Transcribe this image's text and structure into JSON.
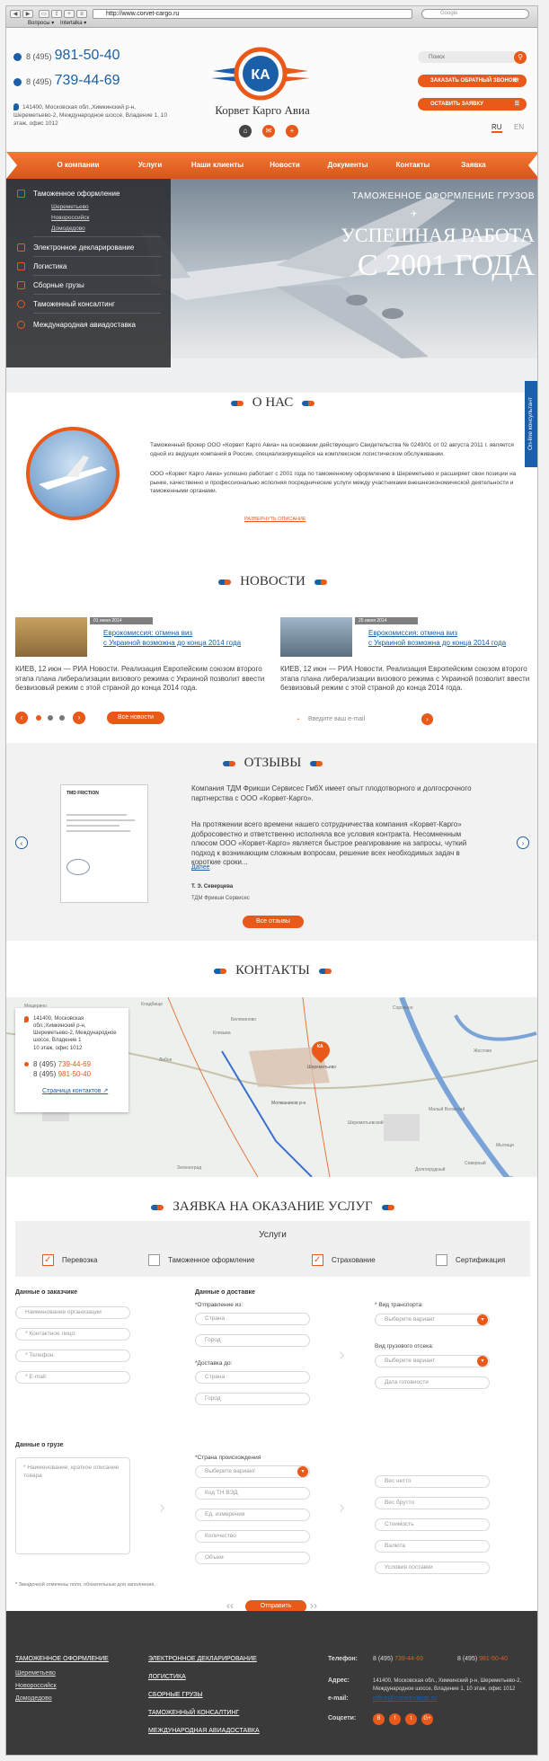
{
  "browser": {
    "url": "http://www.corvet-cargo.ru",
    "search_placeholder": "Google",
    "bookmark1": "Вопросы ▾",
    "bookmark2": "Intertalka ▾"
  },
  "header": {
    "phone_prefix": "8 (495)",
    "phone1": "981-50-40",
    "phone2": "739-44-69",
    "address": "141400, Московская обл.,Химкинский р-н, Шереметьево-2, Международное шоссе, Владение 1, 10 этаж, офис 1012",
    "logo_abbr": "КА",
    "logo_text": "Корвет Карго Авиа",
    "search_placeholder": "Поиск",
    "callback_label": "ЗАКАЗАТЬ ОБРАТНЫЙ ЗВОНОК",
    "request_label": "ОСТАВИТЬ ЗАЯВКУ",
    "lang_ru": "RU",
    "lang_en": "EN"
  },
  "nav": [
    "О компании",
    "Услуги",
    "Наши клиенты",
    "Новости",
    "Документы",
    "Контакты",
    "Заявка"
  ],
  "side_menu": {
    "customs": "Таможенное оформление",
    "subs": [
      "Шереметьево",
      "Новороссийск",
      "Домодедово"
    ],
    "items": [
      "Электронное декларирование",
      "Логистика",
      "Сборные грузы",
      "Таможенный консалтинг",
      "Международная авиадоставка"
    ]
  },
  "hero": {
    "line1": "ТАМОЖЕННОЕ ОФОРМЛЕНИЕ ГРУЗОВ",
    "line2": "УСПЕШНАЯ РАБОТА",
    "line3": "С 2001 ГОДА"
  },
  "online_tab": "On-line консультант",
  "about": {
    "title": "О НАС",
    "p1": "Таможенный брокер ООО «Корвет Карго Авиа» на основании действующего Свидетельства № 0249/01 от 02 августа 2011 г. является одной из ведущих компаний в России, специализирующейся на комплексном логистическом обслуживании.",
    "p2": "ООО «Корвет Карго Авиа» успешно работает с 2001 года по таможенному оформлению в Шереметьево и расширяет свои позиции на рынке, качественно и профессионально исполняя посреднические услуги между участниками внешнеэкономической деятельности и таможенными органами.",
    "expand": "РАЗВЕРНУТЬ ОПИСАНИЕ"
  },
  "news": {
    "title": "НОВОСТИ",
    "items": [
      {
        "date": "01 июня 2014",
        "title1": "Еврокомиссия: отмена виз",
        "title2": "с Украиной возможна до конца 2014 года",
        "text": "КИЕВ, 12 июн — РИА Новости. Реализация Европейским союзом второго этапа плана либерализации визового режима с Украиной позволит ввести безвизовый режим с этой страной до конца 2014 года."
      },
      {
        "date": "25 июня 2014",
        "title1": "Еврокомиссия: отмена виз",
        "title2": "с Украиной возможна до конца 2014 года",
        "text": "КИЕВ, 12 июн — РИА Новости. Реализация Европейским союзом второго этапа плана либерализации визового режима с Украиной позволит ввести безвизовый режим с этой страной до конца 2014 года."
      }
    ],
    "all_label": "Все новости",
    "email_placeholder": "Введите ваш e-mail"
  },
  "reviews": {
    "title": "ОТЗЫВЫ",
    "intro1": "Компания ТДМ Фрикши Сервисес ГмбХ имеет опыт плодотворного и долгосрочного",
    "intro2": "партнерства с ООО «Корвет-Карго».",
    "body": "На протяжении всего времени нашего сотрудничества компания «Корвет-Карго» добросовестно и ответственно исполняла все условия контракта. Несомненным плюсом ООО «Корвет-Карго» является быстрое реагирование на запросы, чуткий подход к возникающим сложным вопросам, решение всех необходимых задач в короткие сроки...",
    "more": "Далее",
    "author": "Т. Э. Северцева",
    "company": "ТДМ Фрикши Сервисес",
    "doc_logo": "TMD FRICTION",
    "all_label": "Все отзывы"
  },
  "contacts": {
    "title": "КОНТАКТЫ",
    "address": "141400, Московская обл.,Химкинский р-н, Шереметьево-2, Международное шоссе, Владение 1",
    "office": "10 этаж, офис 1012",
    "phone_prefix": "8 (495)",
    "phone1": "739-44-69",
    "phone2": "981-50-40",
    "page_link": "Страница контактов",
    "map_labels": [
      "Мещерино",
      "Кладбище",
      "Беляниново",
      "Сорокино",
      "Жостово",
      "Малый Волжский",
      "Мытищи",
      "Лобня",
      "Шереметьево",
      "Молжанинов р-н",
      "Северный",
      "Долгопрудный",
      "Шереметьевский",
      "Зеленоград",
      "Клязьма"
    ]
  },
  "request": {
    "title": "ЗАЯВКА НА ОКАЗАНИЕ УСЛУГ",
    "services_title": "Услуги",
    "services": [
      {
        "label": "Перевозка",
        "checked": true
      },
      {
        "label": "Таможенное оформление",
        "checked": false
      },
      {
        "label": "Страхование",
        "checked": true
      },
      {
        "label": "Сертификация",
        "checked": false
      }
    ],
    "customer_title": "Данные о заказчике",
    "customer_fields": [
      "Наименование организации",
      "* Контактное лицо:",
      "* Телефон:",
      "* E-mail:"
    ],
    "delivery_title": "Данные о доставке",
    "from_label": "*Отправление из:",
    "from_fields": [
      "Страна",
      "Город"
    ],
    "to_label": "*Доставка до:",
    "to_fields": [
      "Страна",
      "Город"
    ],
    "transport_label": "* Вид транспорта:",
    "transport_placeholder": "Выберите вариант",
    "cargo_compartment_label": "Вид грузового отсека:",
    "cargo_compartment_placeholder": "Выберите вариант",
    "ready_date": "Дата готовности",
    "cargo_title": "Данные о грузе",
    "cargo_desc_placeholder": "* Наименование, краткое описание товара",
    "origin_label": "*Страна происхождения",
    "origin_placeholder": "Выберите вариант",
    "cargo_fields": [
      "Код ТН ВЭД",
      "Ед. измерения",
      "Количество",
      "Объем"
    ],
    "right_fields": [
      "Вес нетто",
      "Вес брутто",
      "Стоимость",
      "Валюта",
      "Условия поставки"
    ],
    "required_note": "* Звездочкой отмечены поля, обязательные для заполнения.",
    "submit_label": "Отправить"
  },
  "footer": {
    "col1_title": "ТАМОЖЕННОЕ ОФОРМЛЕНИЕ",
    "col1_items": [
      "Шереметьево",
      "Новороссийск",
      "Домодедово"
    ],
    "col2_items": [
      "ЭЛЕКТРОННОЕ ДЕКЛАРИРОВАНИЕ",
      "ЛОГИСТИКА",
      "СБОРНЫЕ ГРУЗЫ",
      "ТАМОЖЕННЫЙ КОНСАЛТИНГ",
      "МЕЖДУНАРОДНАЯ АВИАДОСТАВКА"
    ],
    "phone_label": "Телефон:",
    "phone_prefix": "8 (495)",
    "phone1": "739-44-69",
    "phone2": "981-50-40",
    "address_label": "Адрес:",
    "address": "141400, Московская обл., Химкинский р-н, Шереметьево-2, Международное шоссе, Владение 1, 10 этаж, офис 1012",
    "email_label": "e-mail:",
    "email": "office@corvet-cargo.ru",
    "social_label": "Соцсети:",
    "social": [
      "В",
      "f",
      "t",
      "G+"
    ]
  },
  "colors": {
    "accent": "#e8591a",
    "brand_blue": "#1b5fa8",
    "footer_bg": "#3a3a3a"
  }
}
